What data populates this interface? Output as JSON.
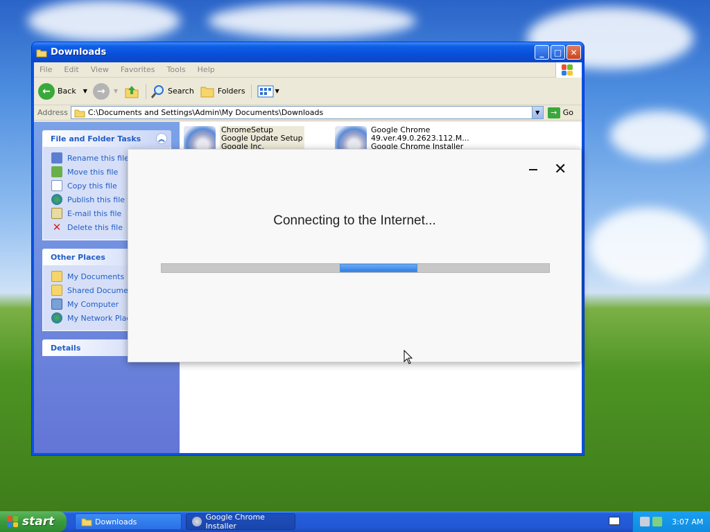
{
  "explorer": {
    "title": "Downloads",
    "menu": [
      "File",
      "Edit",
      "View",
      "Favorites",
      "Tools",
      "Help"
    ],
    "toolbar": {
      "back": "Back",
      "search": "Search",
      "folders": "Folders"
    },
    "address_label": "Address",
    "address_value": "C:\\Documents and Settings\\Admin\\My Documents\\Downloads",
    "go_label": "Go",
    "file_tasks": {
      "title": "File and Folder Tasks",
      "items": [
        "Rename this file",
        "Move this file",
        "Copy this file",
        "Publish this file to t",
        "E-mail this file",
        "Delete this file"
      ]
    },
    "other_places": {
      "title": "Other Places",
      "items": [
        "My Documents",
        "Shared Documents",
        "My Computer",
        "My Network Places"
      ]
    },
    "details": {
      "title": "Details"
    },
    "files": [
      {
        "line1": "ChromeSetup",
        "line2": "Google Update Setup",
        "line3": "Google Inc."
      },
      {
        "line1": "Google Chrome",
        "line2": "49.ver.49.0.2623.112.M...",
        "line3": "Google Chrome Installer"
      }
    ]
  },
  "installer": {
    "status": "Connecting to the Internet...",
    "progress_fraction": 0.2
  },
  "taskbar": {
    "start": "start",
    "buttons": [
      "Downloads",
      "Google Chrome Installer"
    ],
    "clock": "3:07 AM"
  },
  "colors": {
    "xp_blue": "#245edb",
    "start_green": "#3a9a3a",
    "progress_blue": "#2f7fe2"
  }
}
